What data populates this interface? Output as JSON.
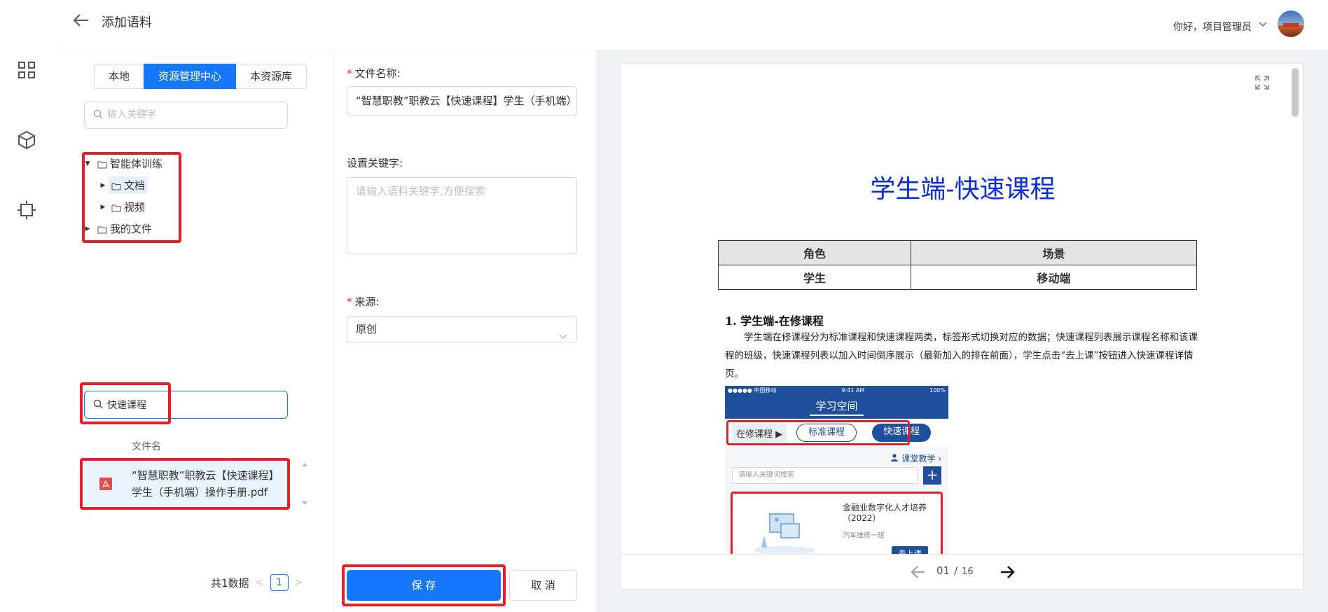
{
  "header": {
    "title": "添加语料",
    "greeting": "你好，项目管理员"
  },
  "source_tabs": [
    {
      "label": "本地",
      "active": false
    },
    {
      "label": "资源管理中心",
      "active": true
    },
    {
      "label": "本资源库",
      "active": false
    }
  ],
  "tree_search": {
    "placeholder": "输入关键字"
  },
  "tree": {
    "root1": "智能体训练",
    "child_docs": "文档",
    "child_videos": "视频",
    "root2": "我的文件"
  },
  "file_search": {
    "value": "快速课程"
  },
  "file_table": {
    "column_name": "文件名",
    "rows": [
      {
        "name": "“智慧职教”职教云【快速课程】学生（手机端）操作手册.pdf"
      }
    ]
  },
  "pager": {
    "total_text": "共1数据",
    "current_page": "1",
    "prev": "<",
    "next": ">"
  },
  "form": {
    "filename_label": "文件名称:",
    "filename_value": "“智慧职教”职教云【快速课程】学生（手机端）操作手册",
    "keywords_label": "设置关键字:",
    "keywords_placeholder": "请输入语料关键字,方便搜索",
    "source_label": "来源:",
    "source_value": "原创",
    "required_mark": "*",
    "save_label": "保 存",
    "cancel_label": "取 消"
  },
  "preview": {
    "doc_title": "学生端-快速课程",
    "table": {
      "headers": [
        "角色",
        "场景"
      ],
      "rows": [
        [
          "学生",
          "移动端"
        ]
      ]
    },
    "section_heading": "1.  学生端-在修课程",
    "section_body": "学生端在修课程分为标准课程和快速课程两类，标签形式切换对应的数据；快速课程列表展示课程名称和该课程的班级，快速课程列表以加入时间倒序展示（最新加入的排在前面），学生点击“去上课”按钮进入快速课程详情页。",
    "phone": {
      "status_left": "●●●●● 中国移动",
      "status_time": "9:41 AM",
      "status_right": "100%",
      "title": "学习空间",
      "current_tab": "在修课程 ▶",
      "tab_standard": "标准课程",
      "tab_quick": "快速课程",
      "link": "课堂教学",
      "search_placeholder": "请输入关键词搜索",
      "plus": "+",
      "card_title": "金融业数字化人才培养（2022）",
      "card_class": "汽车维修一班",
      "card_button": "去上课"
    },
    "current_page": "01",
    "page_separator": "/",
    "total_pages": "16"
  },
  "colors": {
    "primary": "#1677ff",
    "highlight_box": "#e0202a",
    "doc_title": "#0a2dd6",
    "phone_brand": "#1f4e9b"
  }
}
